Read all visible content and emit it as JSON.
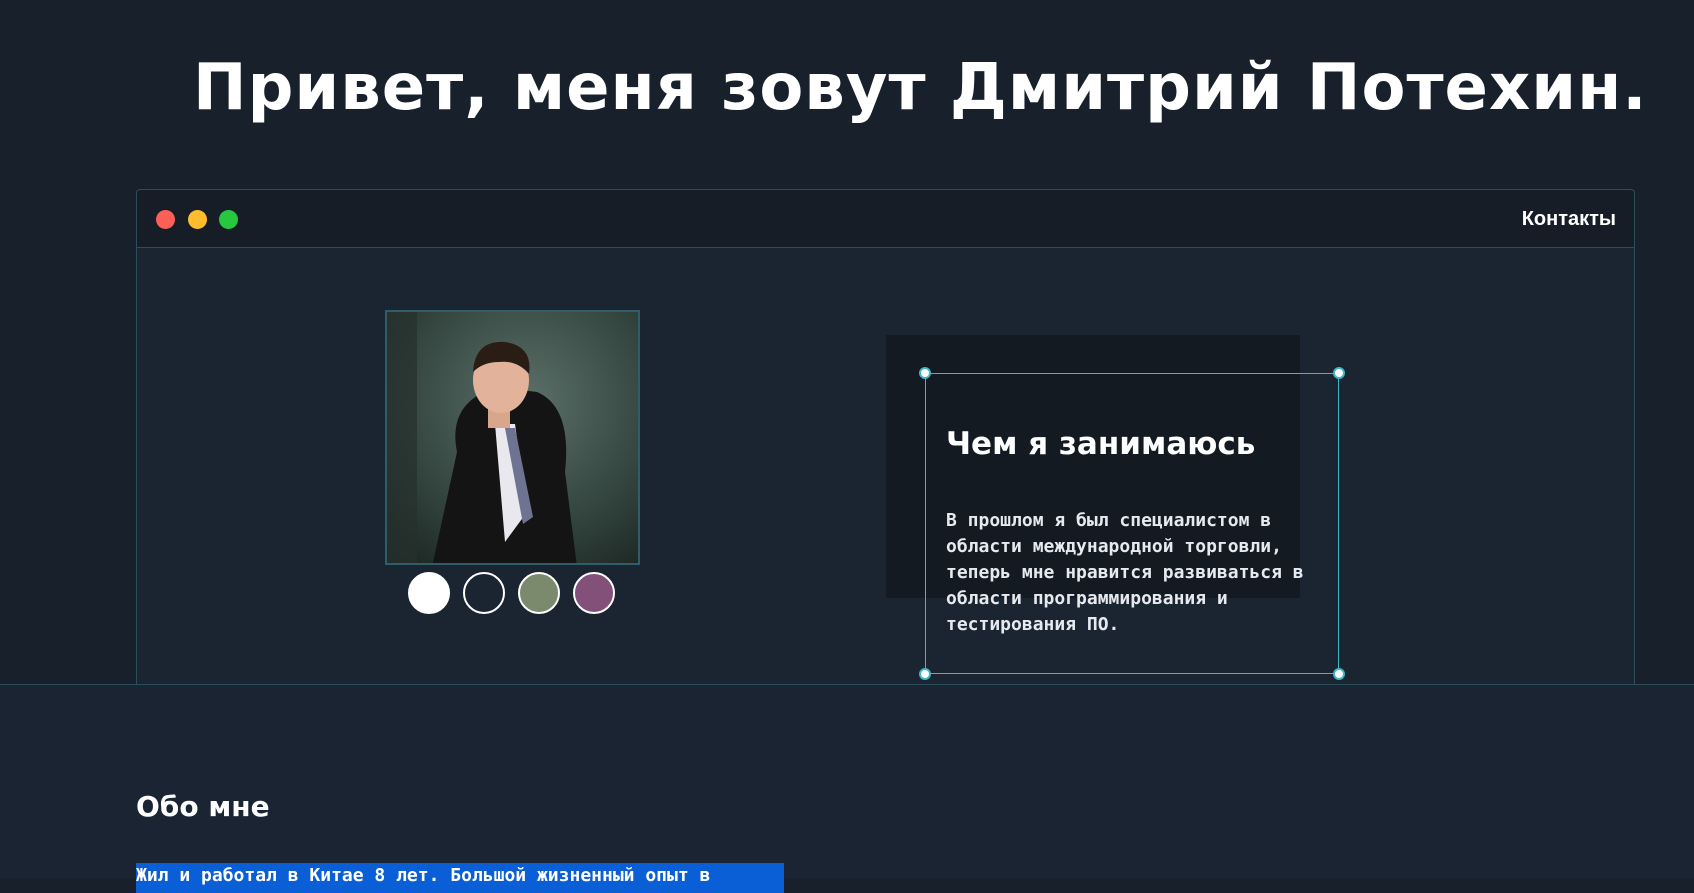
{
  "hero": {
    "title": "Привет, меня зовут Дмитрий Потехин."
  },
  "window": {
    "nav_link": "Контакты",
    "traffic_lights": [
      "#fe5f57",
      "#febc2e",
      "#27c840"
    ]
  },
  "profile": {
    "photo_icon": "person-photo",
    "swatches": [
      {
        "color": "#ffffff"
      },
      {
        "color": "#1b2431"
      },
      {
        "color": "#7b8a6c"
      },
      {
        "color": "#83507a"
      }
    ]
  },
  "card": {
    "title": "Чем я занимаюсь",
    "text": "В прошлом я был специалистом в области международной торговли, теперь мне нравится развиваться в области программирования и тестирования ПО."
  },
  "about": {
    "title": "Обо мне",
    "text": "Жил и работал в Китае 8 лет. Большой жизненный опыт в"
  },
  "colors": {
    "background": "#17202b",
    "accent": "#3fb7c6",
    "selection": "#0b5fd6"
  }
}
